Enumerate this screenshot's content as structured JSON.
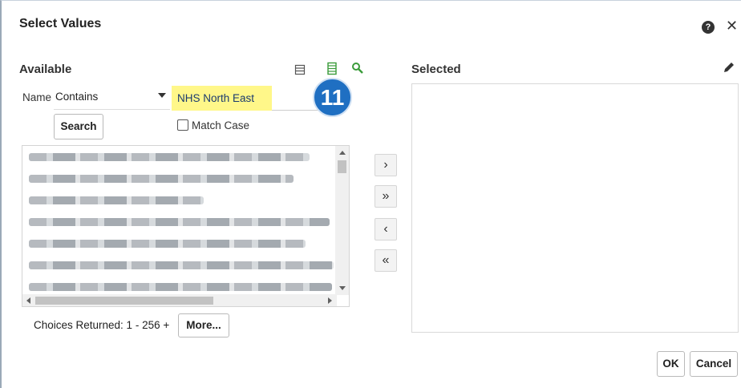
{
  "dialog": {
    "title": "Select Values",
    "help_glyph": "?",
    "close_glyph": "✕"
  },
  "available": {
    "title": "Available",
    "tools": [
      "list-view-icon",
      "column-view-icon",
      "search-icon"
    ],
    "name_label": "Name",
    "operator": "Contains",
    "search_value": "NHS North East",
    "search_button": "Search",
    "match_case_label": "Match Case",
    "choices_label": "Choices Returned: 1 - 256 +",
    "more_button": "More..."
  },
  "annotation": {
    "step_number": "11"
  },
  "move_buttons": {
    "move_one": "›",
    "move_all": "»",
    "remove_one": "‹",
    "remove_all": "«"
  },
  "selected": {
    "title": "Selected"
  },
  "footer": {
    "ok": "OK",
    "cancel": "Cancel"
  },
  "colors": {
    "highlight": "#fff789",
    "badge": "#1f6fc2",
    "tool_icon_green": "#3a9b3a"
  }
}
